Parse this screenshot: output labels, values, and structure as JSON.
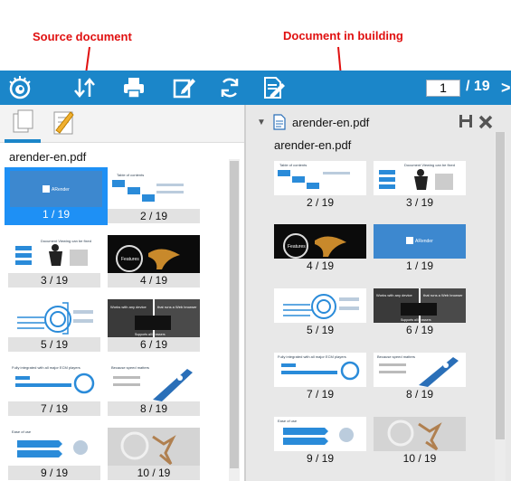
{
  "annotations": {
    "source_label": "Source document",
    "building_label": "Document in building",
    "arrow_color": "#e01010"
  },
  "toolbar": {
    "background": "#1b86c9",
    "icons": [
      "eye-logo-icon",
      "sort-arrows-icon",
      "print-icon",
      "edit-icon",
      "refresh-icon",
      "document-edit-icon"
    ],
    "current_page": "1",
    "total_pages": "/ 19",
    "next_glyph": ">"
  },
  "left_panel": {
    "tabs": [
      "pages-tab-icon",
      "annotations-tab-icon"
    ],
    "doc_name": "arender-en.pdf",
    "thumbnails": [
      {
        "label": "1 / 19",
        "selected": true
      },
      {
        "label": "2 / 19"
      },
      {
        "label": "3 / 19"
      },
      {
        "label": "4 / 19"
      },
      {
        "label": "5 / 19"
      },
      {
        "label": "6 / 19"
      },
      {
        "label": "7 / 19"
      },
      {
        "label": "8 / 19"
      },
      {
        "label": "9 / 19"
      },
      {
        "label": "10 / 19"
      }
    ]
  },
  "right_panel": {
    "doc_title": "arender-en.pdf",
    "doc_name": "arender-en.pdf",
    "thumbnails": [
      {
        "label": "2 / 19"
      },
      {
        "label": "3 / 19"
      },
      {
        "label": "4 / 19"
      },
      {
        "label": "1 / 19"
      },
      {
        "label": "5 / 19"
      },
      {
        "label": "6 / 19"
      },
      {
        "label": "7 / 19"
      },
      {
        "label": "8 / 19"
      },
      {
        "label": "9 / 19"
      },
      {
        "label": "10 / 19"
      }
    ]
  },
  "slides": {
    "toc": "Table of contents",
    "viewing": "Document Viewing can be fixed",
    "features": "Features",
    "arender": "ARender",
    "works": "Works with any device",
    "runs": "that runs a Web browser",
    "supports": "Supports all browsers",
    "ecm": "Fully integrated with all major ECM players",
    "speed": "Because speed matters",
    "ease": "Ease of use"
  }
}
